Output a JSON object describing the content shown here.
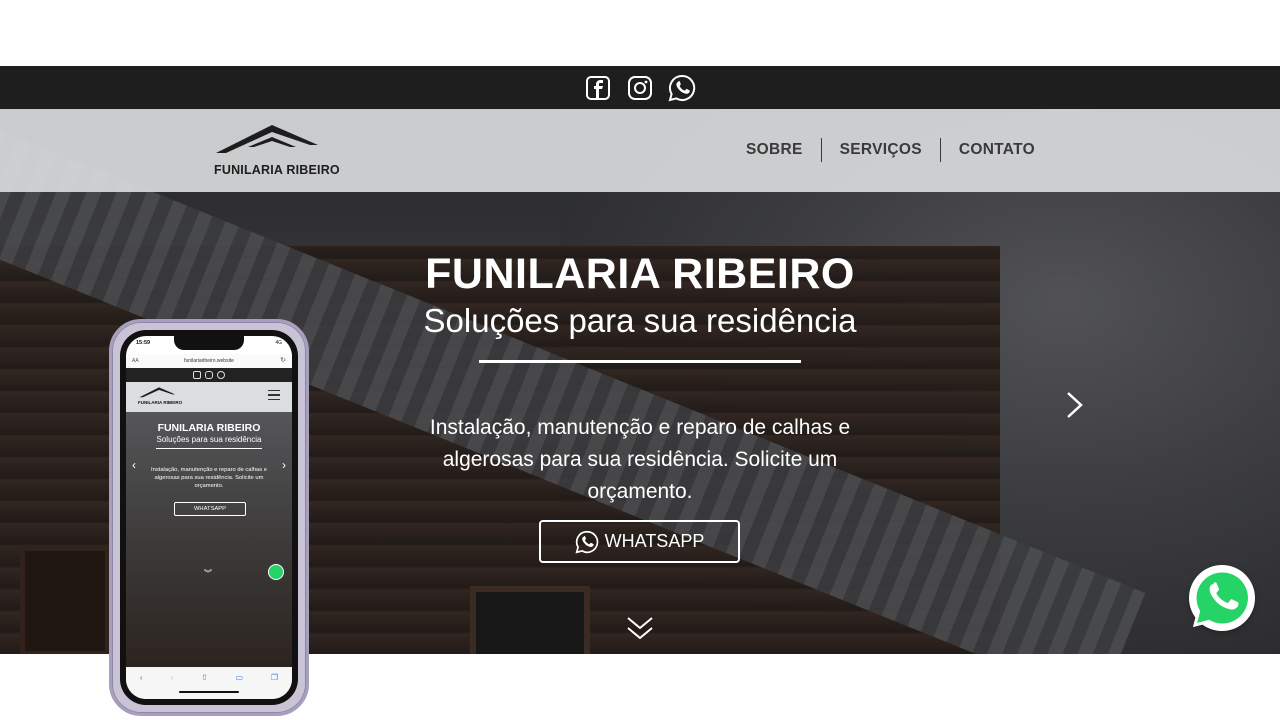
{
  "social": {
    "icons": [
      "facebook-icon",
      "instagram-icon",
      "whatsapp-icon"
    ]
  },
  "brand": {
    "logo_text": "FUNILARIA RIBEIRO"
  },
  "nav": {
    "items": [
      {
        "label": "SOBRE"
      },
      {
        "label": "SERVIÇOS"
      },
      {
        "label": "CONTATO"
      }
    ]
  },
  "hero": {
    "title": "FUNILARIA RIBEIRO",
    "subtitle": "Soluções para sua residência",
    "description": "Instalação, manutenção e reparo de calhas e algerosas para sua residência. Solicite um orçamento.",
    "button_label": "WHATSAPP"
  },
  "phone": {
    "time": "15:59",
    "signal": "4G",
    "url": "funilariaribeiro.website",
    "aa": "AA",
    "logo_text": "FUNILARIA RIBEIRO",
    "title": "FUNILARIA RIBEIRO",
    "subtitle": "Soluções para sua residência",
    "description": "Instalação, manutenção e reparo de calhas e algerosas para sua residência. Solicite um orçamento.",
    "button_label": "WHATSAPP"
  },
  "colors": {
    "topbar": "#1e1e1e",
    "navbar": "#dcdee0",
    "whatsapp": "#25d366",
    "text_light": "#ffffff"
  }
}
